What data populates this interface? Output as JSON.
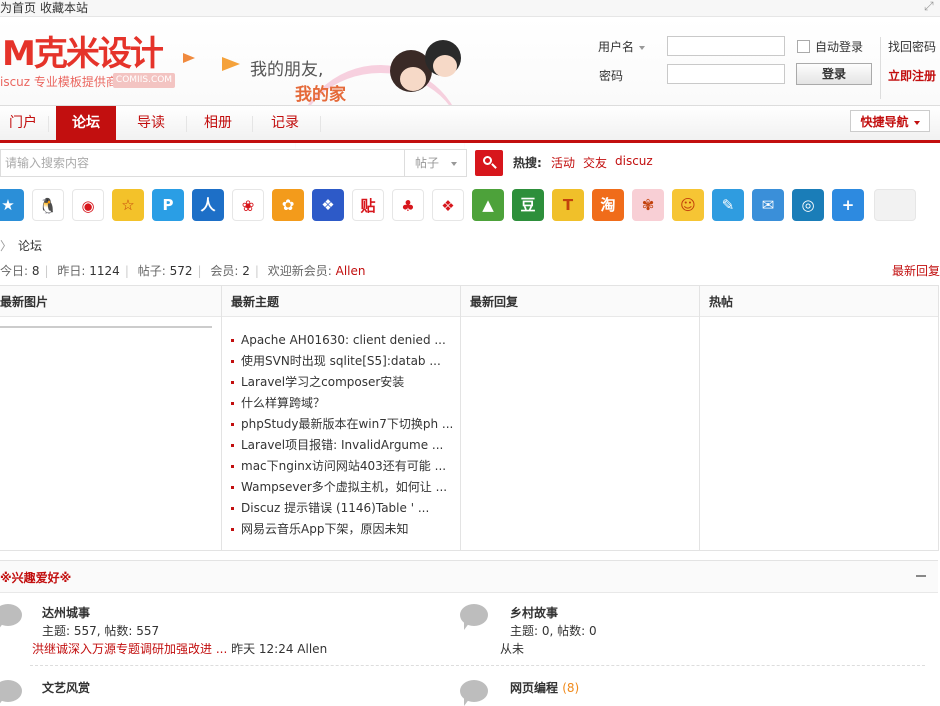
{
  "topbar": {
    "home": "为首页",
    "favorite": "收藏本站",
    "close_icon": "expand-icon"
  },
  "header": {
    "logo_text": "克米设计",
    "logo_m": "M",
    "logo_sub": "iscuz 专业模板提供商",
    "logo_badge": "COMIIS.COM",
    "banner_line1": "我的朋友,",
    "banner_line2": "我的家"
  },
  "login": {
    "username_label": "用户名",
    "password_label": "密码",
    "username_value": "",
    "password_value": "",
    "auto_login": "自动登录",
    "login_button": "登录",
    "find_password": "找回密码",
    "register": "立即注册"
  },
  "nav": {
    "items": [
      "门户",
      "论坛",
      "导读",
      "相册",
      "记录"
    ],
    "active": "论坛",
    "quick_nav": "快捷导航"
  },
  "search": {
    "placeholder": "请输入搜索内容",
    "type_selected": "帖子",
    "hot_label": "热搜:",
    "hot_terms": [
      "活动",
      "交友",
      "discuz"
    ]
  },
  "share_icons": [
    {
      "name": "qzone-icon",
      "bg": "#2b8fd8",
      "glyph": "★"
    },
    {
      "name": "qq-icon",
      "bg": "#ffffff",
      "glyph": "🐧"
    },
    {
      "name": "weibo-icon",
      "bg": "#ffffff",
      "glyph": "◉"
    },
    {
      "name": "qq-star-icon",
      "bg": "#f3c22a",
      "glyph": "☆"
    },
    {
      "name": "pengyou-icon",
      "bg": "#2a9ee5",
      "glyph": "P"
    },
    {
      "name": "renren-icon",
      "bg": "#1d6fc7",
      "glyph": "人"
    },
    {
      "name": "kaixin-icon",
      "bg": "#ffffff",
      "glyph": "❀"
    },
    {
      "name": "qq-show-icon",
      "bg": "#f39b1b",
      "glyph": "✿"
    },
    {
      "name": "baidu-icon",
      "bg": "#2d5ac8",
      "glyph": "❖"
    },
    {
      "name": "tieba-icon",
      "bg": "#ffffff",
      "glyph": "贴"
    },
    {
      "name": "clover-icon",
      "bg": "#ffffff",
      "glyph": "♣"
    },
    {
      "name": "baidu-paw-icon",
      "bg": "#ffffff",
      "glyph": "❖"
    },
    {
      "name": "youdao-icon",
      "bg": "#4da23a",
      "glyph": "▲"
    },
    {
      "name": "douban-icon",
      "bg": "#2d8f3b",
      "glyph": "豆"
    },
    {
      "name": "tianya-icon",
      "bg": "#f0c02a",
      "glyph": "T"
    },
    {
      "name": "taobao-icon",
      "bg": "#f06c1a",
      "glyph": "淘"
    },
    {
      "name": "flower-icon",
      "bg": "#f8cfd5",
      "glyph": "✾"
    },
    {
      "name": "smile-icon",
      "bg": "#f6c534",
      "glyph": "☺"
    },
    {
      "name": "pen-icon",
      "bg": "#2f9ce0",
      "glyph": "✎"
    },
    {
      "name": "mail-icon",
      "bg": "#3a8fd9",
      "glyph": "✉"
    },
    {
      "name": "ring-icon",
      "bg": "#1a7db8",
      "glyph": "◎"
    },
    {
      "name": "plus-icon",
      "bg": "#2d8ae0",
      "glyph": "+"
    },
    {
      "name": "blank-icon",
      "bg": "#f2f2f2",
      "glyph": ""
    }
  ],
  "breadcrumb": {
    "current": "论坛"
  },
  "stats": {
    "today_label": "今日:",
    "today": "8",
    "yesterday_label": "昨日:",
    "yesterday": "1124",
    "posts_label": "帖子:",
    "posts": "572",
    "members_label": "会员:",
    "members": "2",
    "welcome_label": "欢迎新会员:",
    "new_member": "Allen",
    "latest_reply": "最新回复"
  },
  "columns": {
    "pics": "最新图片",
    "topics": "最新主题",
    "replies": "最新回复",
    "hot": "热帖"
  },
  "latest_topics": [
    "Apache AH01630: client denied ...",
    "使用SVN时出现 sqlite[S5]:datab ...",
    "Laravel学习之composer安装",
    "什么样算跨域？",
    "phpStudy最新版本在win7下切换ph ...",
    "Laravel项目报错: InvalidArgume ...",
    "mac下nginx访问网站403还有可能 ...",
    "Wampsever多个虚拟主机，如何让 ...",
    "Discuz 提示错误 (1146)Table ' ...",
    "网易云音乐App下架，原因未知"
  ],
  "interest": {
    "title": "※兴趣爱好※",
    "forums": [
      {
        "name": "达州城事",
        "stat": "主题: 557, 帖数: 557",
        "last_link": "洪继诚深入万源专题调研加强改进 ...",
        "last_meta": "昨天 12:24 Allen"
      },
      {
        "name": "乡村故事",
        "stat": "主题: 0, 帖数: 0",
        "last_meta": "从未"
      },
      {
        "name": "文艺风赏",
        "stat": "",
        "last_meta": ""
      },
      {
        "name": "网页编程",
        "badge": "(8)",
        "stat": "",
        "last_meta": ""
      }
    ]
  },
  "colors": {
    "brand_red": "#c20f0f",
    "search_red": "#d7161c"
  }
}
